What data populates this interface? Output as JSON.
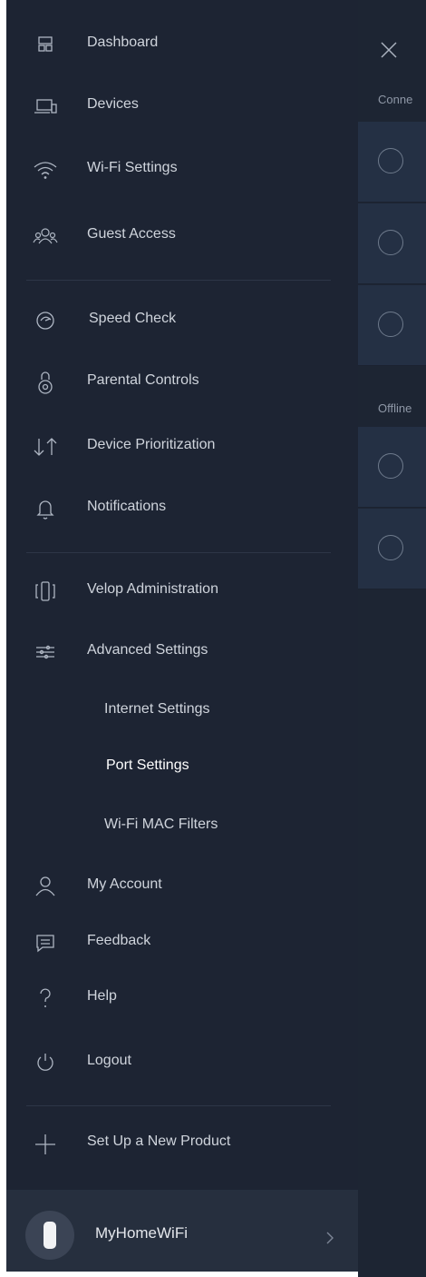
{
  "background": {
    "sections": [
      "Conne",
      "Offline"
    ],
    "colors": {
      "panel": "#1d2533",
      "card": "#243044"
    }
  },
  "menu": {
    "group1": [
      {
        "label": "Dashboard",
        "icon": "dashboard-icon"
      },
      {
        "label": "Devices",
        "icon": "devices-icon"
      },
      {
        "label": "Wi-Fi Settings",
        "icon": "wifi-icon"
      },
      {
        "label": "Guest Access",
        "icon": "guest-access-icon"
      }
    ],
    "group2": [
      {
        "label": "Speed Check",
        "icon": "speedometer-icon"
      },
      {
        "label": "Parental Controls",
        "icon": "lock-icon"
      },
      {
        "label": "Device Prioritization",
        "icon": "priority-arrows-icon"
      },
      {
        "label": "Notifications",
        "icon": "bell-icon"
      }
    ],
    "group3": [
      {
        "label": "Velop Administration",
        "icon": "velop-node-icon"
      },
      {
        "label": "Advanced Settings",
        "icon": "sliders-icon"
      }
    ],
    "advanced_sub": [
      {
        "label": "Internet Settings",
        "active": false
      },
      {
        "label": "Port Settings",
        "active": true
      },
      {
        "label": "Wi-Fi MAC Filters",
        "active": false
      }
    ],
    "group4": [
      {
        "label": "My Account",
        "icon": "user-icon"
      },
      {
        "label": "Feedback",
        "icon": "chat-bubble-icon"
      },
      {
        "label": "Help",
        "icon": "question-icon"
      },
      {
        "label": "Logout",
        "icon": "power-icon"
      }
    ],
    "group5": [
      {
        "label": "Set Up a New Product",
        "icon": "plus-icon"
      }
    ]
  },
  "account": {
    "network_name": "MyHomeWiFi",
    "icon": "velop-node-icon"
  },
  "colors": {
    "drawer_bg": "#1d2433",
    "account_bar_bg": "#262f3e",
    "text": "#cfd4dc",
    "active_text": "#ffffff"
  }
}
